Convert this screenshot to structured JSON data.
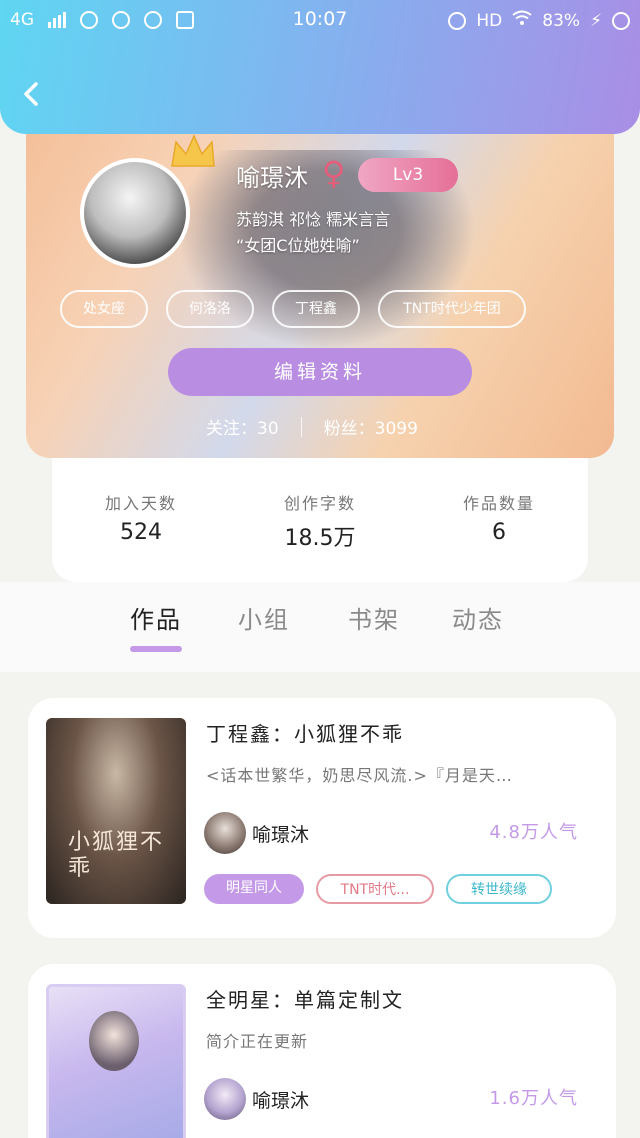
{
  "status_bar": {
    "network": "4G",
    "time": "10:07",
    "hd": "HD",
    "battery": "83%"
  },
  "header": {
    "back_icon": "chevron-left-icon"
  },
  "profile": {
    "username": "喻璟沐",
    "gender_symbol": "♀",
    "level": "Lv3",
    "friends_line": "苏韵淇 祁惗 糯米言言",
    "quote": "“女团C位她姓喻”",
    "tags": [
      "处女座",
      "何洛洛",
      "丁程鑫",
      "TNT时代少年团"
    ],
    "edit_button": "编辑资料",
    "follow_label": "关注：30",
    "fans_label": "粉丝：3099",
    "accent_color": "#b98ee2"
  },
  "stats": [
    {
      "label": "加入天数",
      "value": "524"
    },
    {
      "label": "创作字数",
      "value": "18.5万"
    },
    {
      "label": "作品数量",
      "value": "6"
    }
  ],
  "tabs": [
    {
      "label": "作品",
      "active": true
    },
    {
      "label": "小组",
      "active": false
    },
    {
      "label": "书架",
      "active": false
    },
    {
      "label": "动态",
      "active": false
    }
  ],
  "works": [
    {
      "title": "丁程鑫：小狐狸不乖",
      "desc": "<话本世繁华，奶思尽风流.>『月是天…",
      "author": "喻璟沐",
      "popularity": "4.8万人气",
      "cover_text": "小狐狸不乖",
      "tags": [
        "明星同人",
        "TNT时代...",
        "转世续缘"
      ]
    },
    {
      "title": "全明星：单篇定制文",
      "desc": "简介正在更新",
      "author": "喻璟沐",
      "popularity": "1.6万人气"
    }
  ]
}
